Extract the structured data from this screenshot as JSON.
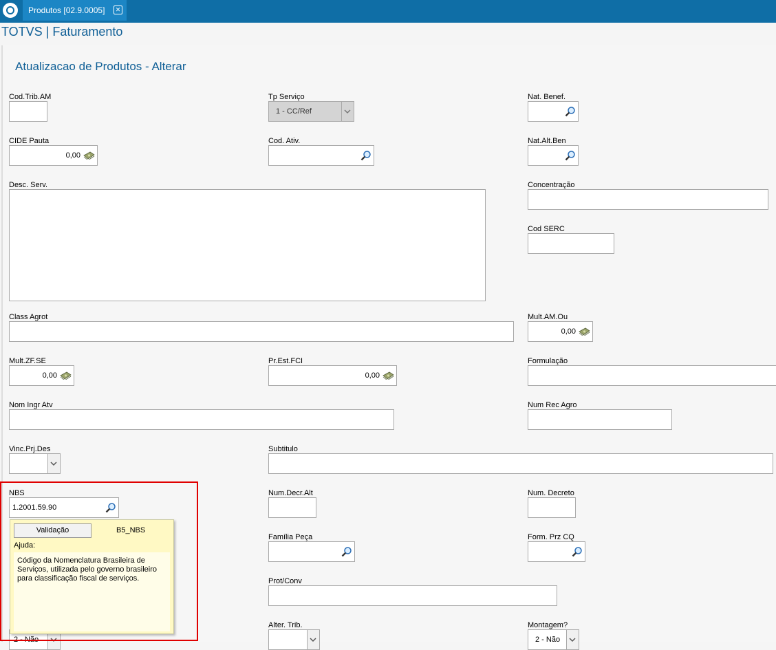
{
  "window": {
    "tab_title": "Produtos [02.9.0005]",
    "close_symbol": "✕"
  },
  "app": {
    "title": "TOTVS | Faturamento"
  },
  "page": {
    "title": "Atualizacao de Produtos - Alterar"
  },
  "fields": {
    "cod_trib_am": {
      "label": "Cod.Trib.AM",
      "value": ""
    },
    "tp_servico": {
      "label": "Tp Serviço",
      "value": "1 - CC/Ref"
    },
    "nat_benef": {
      "label": "Nat. Benef.",
      "value": ""
    },
    "cide_pauta": {
      "label": "CIDE Pauta",
      "value": "0,00"
    },
    "cod_ativ": {
      "label": "Cod. Ativ.",
      "value": ""
    },
    "nat_alt_ben": {
      "label": "Nat.Alt.Ben",
      "value": ""
    },
    "desc_serv": {
      "label": "Desc. Serv.",
      "value": ""
    },
    "concentracao": {
      "label": "Concentração",
      "value": ""
    },
    "cod_serc": {
      "label": "Cod SERC",
      "value": ""
    },
    "class_agrot": {
      "label": "Class Agrot",
      "value": ""
    },
    "mult_am_ou": {
      "label": "Mult.AM.Ou",
      "value": "0,00"
    },
    "mult_zf_se": {
      "label": "Mult.ZF.SE",
      "value": "0,00"
    },
    "pr_est_fci": {
      "label": "Pr.Est.FCI",
      "value": "0,00"
    },
    "formulacao": {
      "label": "Formulação",
      "value": ""
    },
    "nom_ingr_atv": {
      "label": "Nom Ingr Atv",
      "value": ""
    },
    "num_rec_agro": {
      "label": "Num Rec Agro",
      "value": ""
    },
    "vinc_prj_des": {
      "label": "Vinc.Prj.Des",
      "value": ""
    },
    "subtitulo": {
      "label": "Subtitulo",
      "value": ""
    },
    "nbs": {
      "label": "NBS",
      "value": "1.2001.59.90"
    },
    "num_decr_alt": {
      "label": "Num.Decr.Alt",
      "value": ""
    },
    "num_decreto": {
      "label": "Num. Decreto",
      "value": ""
    },
    "familia_peca": {
      "label": "Família Peça",
      "value": ""
    },
    "form_prz_cq": {
      "label": "Form. Prz CQ",
      "value": ""
    },
    "prot_conv": {
      "label": "Prot/Conv",
      "value": ""
    },
    "hidden_left_select": {
      "value": "2 - Não"
    },
    "alter_trib": {
      "label": "Alter. Trib.",
      "value": ""
    },
    "montagem": {
      "label": "Montagem?",
      "value": "2 - Não"
    }
  },
  "tooltip": {
    "button_label": "Validação",
    "field_name": "B5_NBS",
    "help_label": "Ajuda:",
    "help_text": "Código da Nomenclatura Brasileira de Serviços, utilizada pelo governo brasileiro para classificação fiscal de serviços."
  },
  "colors": {
    "header": "#0f6ea6",
    "tab": "#1c86c5",
    "title_text": "#0f5f96",
    "highlight": "#e00000",
    "tooltip_bg": "#fff9c4"
  }
}
